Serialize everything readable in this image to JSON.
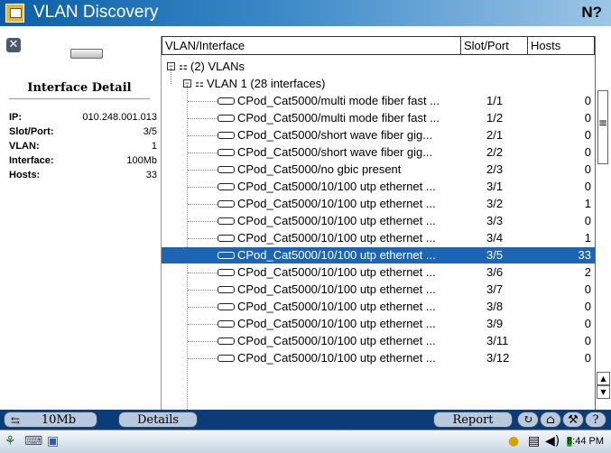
{
  "app": {
    "title": "VLAN Discovery",
    "help_symbol": "N?"
  },
  "detail": {
    "title": "Interface Detail",
    "rows": [
      {
        "label": "IP:",
        "value": "010.248.001.013"
      },
      {
        "label": "Slot/Port:",
        "value": "3/5"
      },
      {
        "label": "VLAN:",
        "value": "1"
      },
      {
        "label": "Interface:",
        "value": "100Mb"
      },
      {
        "label": "Hosts:",
        "value": "33"
      }
    ]
  },
  "table": {
    "headers": {
      "name": "VLAN/Interface",
      "slot": "Slot/Port",
      "hosts": "Hosts"
    },
    "root": "(2) VLANs",
    "vlan": "VLAN 1 (28 interfaces)",
    "rows": [
      {
        "name": "CPod_Cat5000/multi mode fiber fast ...",
        "slot": "1/1",
        "hosts": "0"
      },
      {
        "name": "CPod_Cat5000/multi mode fiber fast ...",
        "slot": "1/2",
        "hosts": "0"
      },
      {
        "name": "CPod_Cat5000/short wave fiber gig...",
        "slot": "2/1",
        "hosts": "0"
      },
      {
        "name": "CPod_Cat5000/short wave fiber gig...",
        "slot": "2/2",
        "hosts": "0"
      },
      {
        "name": "CPod_Cat5000/no gbic present",
        "slot": "2/3",
        "hosts": "0"
      },
      {
        "name": "CPod_Cat5000/10/100 utp ethernet ...",
        "slot": "3/1",
        "hosts": "0"
      },
      {
        "name": "CPod_Cat5000/10/100 utp ethernet ...",
        "slot": "3/2",
        "hosts": "1"
      },
      {
        "name": "CPod_Cat5000/10/100 utp ethernet ...",
        "slot": "3/3",
        "hosts": "0"
      },
      {
        "name": "CPod_Cat5000/10/100 utp ethernet ...",
        "slot": "3/4",
        "hosts": "1"
      },
      {
        "name": "CPod_Cat5000/10/100 utp ethernet ...",
        "slot": "3/5",
        "hosts": "33",
        "selected": true
      },
      {
        "name": "CPod_Cat5000/10/100 utp ethernet ...",
        "slot": "3/6",
        "hosts": "2"
      },
      {
        "name": "CPod_Cat5000/10/100 utp ethernet ...",
        "slot": "3/7",
        "hosts": "0"
      },
      {
        "name": "CPod_Cat5000/10/100 utp ethernet ...",
        "slot": "3/8",
        "hosts": "0"
      },
      {
        "name": "CPod_Cat5000/10/100 utp ethernet ...",
        "slot": "3/9",
        "hosts": "0"
      },
      {
        "name": "CPod_Cat5000/10/100 utp ethernet ...",
        "slot": "3/11",
        "hosts": "0"
      },
      {
        "name": "CPod_Cat5000/10/100 utp ethernet ...",
        "slot": "3/12",
        "hosts": "0"
      }
    ]
  },
  "toolbar": {
    "speed": "10Mb",
    "details": "Details",
    "report": "Report"
  },
  "sysbar": {
    "clock": "8:44 PM"
  }
}
